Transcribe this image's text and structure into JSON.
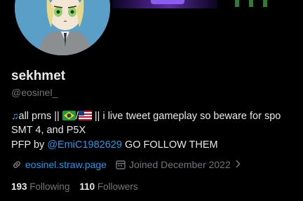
{
  "profile": {
    "display_name": "sekhmet",
    "handle": "@eosinel_",
    "bio": {
      "note_icon": "♫",
      "line1_pre": "all prns || ",
      "line1_sep": "/",
      "line1_post": " || i live tweet gameplay so beware for spo",
      "line2": "SMT 4, and P5X",
      "line3_pre": "PFP by ",
      "line3_mention": "@EmiC1982629",
      "line3_post": " GO FOLLOW THEM"
    },
    "website": "eosinel.straw.page",
    "joined": "Joined December 2022",
    "following_count": "193",
    "following_label": "Following",
    "followers_count": "110",
    "followers_label": "Followers"
  },
  "icons": {
    "flag1": "brazil-flag",
    "flag2": "us-flag",
    "link": "link-icon",
    "calendar": "calendar-icon"
  },
  "colors": {
    "background": "#000000",
    "text": "#e7e9ea",
    "secondary": "#71767b",
    "accent": "#1d9bf0",
    "avatar_bg": "#5a9fc8"
  }
}
